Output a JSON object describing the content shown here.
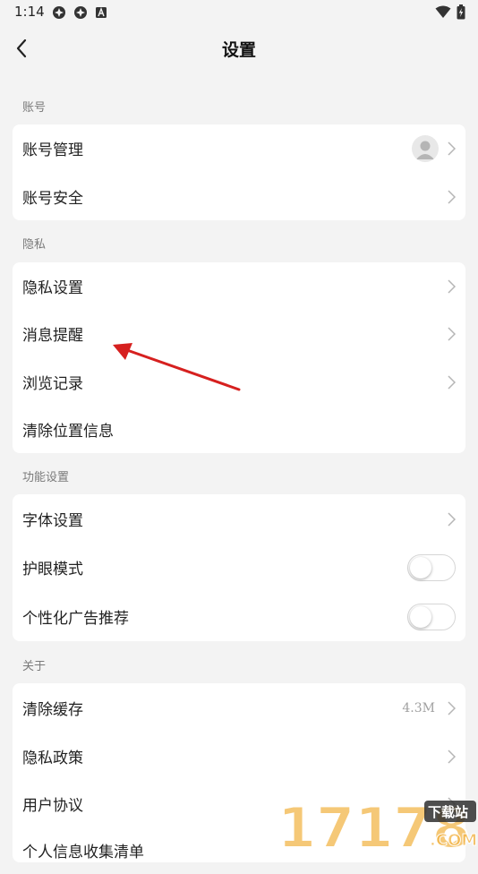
{
  "status_bar": {
    "time": "1:14"
  },
  "nav": {
    "title": "设置"
  },
  "sections": {
    "account": {
      "header": "账号",
      "items": [
        "账号管理",
        "账号安全"
      ]
    },
    "privacy": {
      "header": "隐私",
      "items": [
        "隐私设置",
        "消息提醒",
        "浏览记录",
        "清除位置信息"
      ]
    },
    "features": {
      "header": "功能设置",
      "items": [
        "字体设置",
        "护眼模式",
        "个性化广告推荐"
      ],
      "eye_mode_enabled": false,
      "personalized_ads_enabled": false
    },
    "about": {
      "header": "关于",
      "items": [
        "清除缓存",
        "隐私政策",
        "用户协议",
        "个人信息收集清单"
      ],
      "cache_size": "4.3M"
    }
  },
  "watermark": {
    "digits": "17178",
    "badge": "下载站",
    "suffix": ".COM"
  },
  "colors": {
    "background": "#f3f3f3",
    "card": "#ffffff",
    "annotation_arrow": "#d6201f"
  }
}
